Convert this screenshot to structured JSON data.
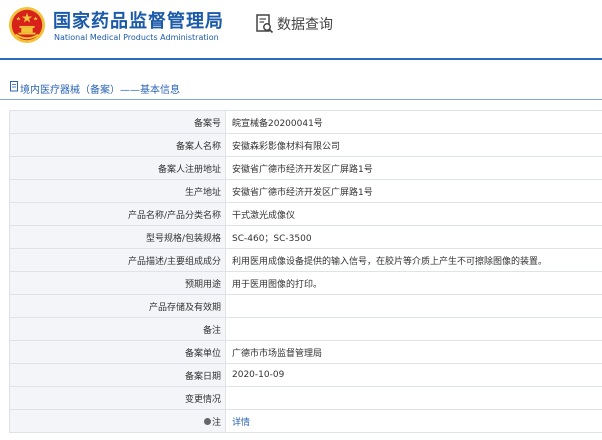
{
  "header": {
    "title": "国家药品监督管理局",
    "subtitle": "National Medical Products Administration",
    "query_label": "数据查询"
  },
  "section": {
    "title": "境内医疗器械（备案）——基本信息"
  },
  "rows": [
    {
      "label": "备案号",
      "value": "皖宣械备20200041号"
    },
    {
      "label": "备案人名称",
      "value": "安徽森彩影像材料有限公司"
    },
    {
      "label": "备案人注册地址",
      "value": "安徽省广德市经济开发区广屏路1号"
    },
    {
      "label": "生产地址",
      "value": "安徽省广德市经济开发区广屏路1号"
    },
    {
      "label": "产品名称/产品分类名称",
      "value": "干式激光成像仪"
    },
    {
      "label": "型号规格/包装规格",
      "value": "SC-460；SC-3500"
    },
    {
      "label": "产品描述/主要组成成分",
      "value": "利用医用成像设备提供的输入信号，在胶片等介质上产生不可擦除图像的装置。"
    },
    {
      "label": "预期用途",
      "value": "用于医用图像的打印。"
    },
    {
      "label": "产品存储及有效期",
      "value": ""
    },
    {
      "label": "备注",
      "value": ""
    },
    {
      "label": "备案单位",
      "value": "广德市市场监督管理局"
    },
    {
      "label": "备案日期",
      "value": "2020-10-09"
    },
    {
      "label": "变更情况",
      "value": ""
    },
    {
      "label": "注",
      "value": "详情"
    }
  ],
  "colors": {
    "brand": "#1b5aa8",
    "accent": "#2a64b6",
    "emblem_red": "#d7211b",
    "emblem_gold": "#f3c23b"
  },
  "icons": {
    "emblem": "national-emblem-icon",
    "query": "search-document-icon",
    "section": "document-icon",
    "tip": "info-dot-icon"
  }
}
